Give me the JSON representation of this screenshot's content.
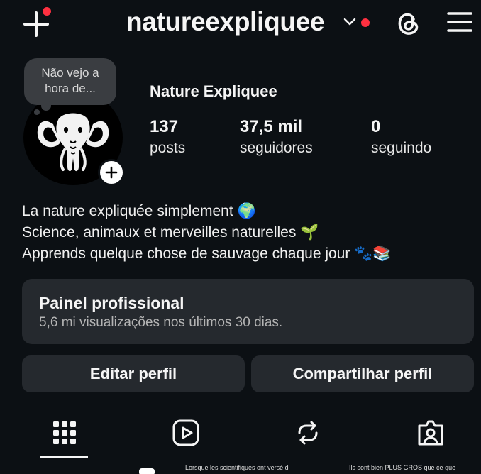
{
  "header": {
    "username": "natureexpliquee"
  },
  "note": {
    "line1": "Não vejo a",
    "line2": "hora de..."
  },
  "profile": {
    "display_name": "Nature Expliquee",
    "stats": [
      {
        "value": "137",
        "label": "posts"
      },
      {
        "value": "37,5 mil",
        "label": "seguidores"
      },
      {
        "value": "0",
        "label": "seguindo"
      }
    ]
  },
  "bio": {
    "line1": "La nature expliquée simplement 🌍",
    "line2": "Science, animaux et merveilles naturelles 🌱",
    "line3": "Apprends quelque chose de sauvage chaque jour 🐾📚"
  },
  "dashboard": {
    "title": "Painel profissional",
    "subtitle": "5,6 mi visualizações nos últimos 30 dias."
  },
  "actions": {
    "edit": "Editar perfil",
    "share": "Compartilhar perfil"
  },
  "tabs": [
    {
      "icon": "grid-icon",
      "active": true
    },
    {
      "icon": "reels-icon",
      "active": false
    },
    {
      "icon": "reposts-icon",
      "active": false
    },
    {
      "icon": "tagged-icon",
      "active": false
    }
  ],
  "thumbnails": [
    {
      "caption": ""
    },
    {
      "caption": "Lorsque les scientifiques ont versé d"
    },
    {
      "caption": "Ils sont bien PLUS GROS que ce que"
    }
  ],
  "colors": {
    "background": "#0c1014",
    "card": "#25292e",
    "notification": "#ff3040",
    "text": "#f5f5f5"
  }
}
